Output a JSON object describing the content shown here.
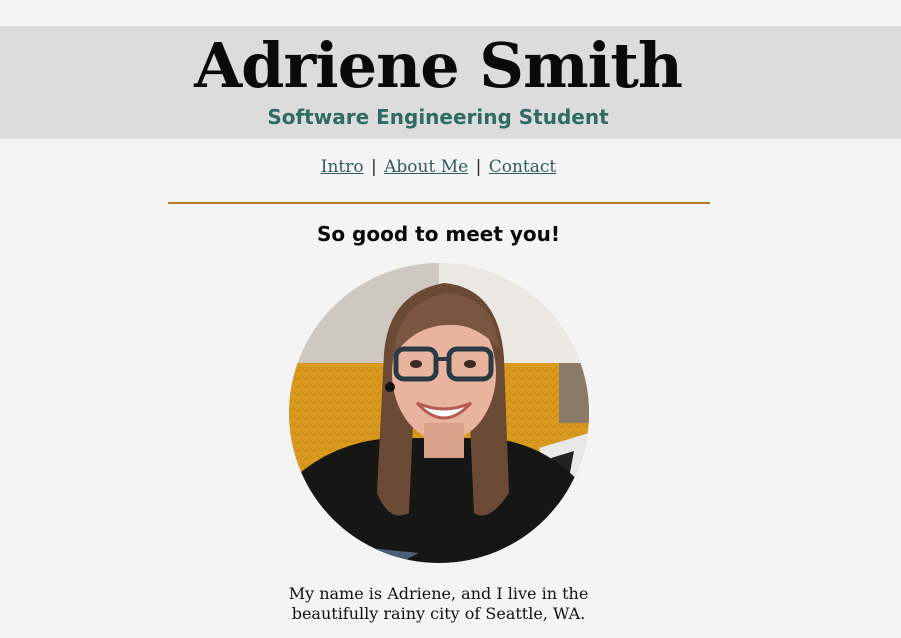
{
  "header": {
    "title": "Adriene Smith",
    "subtitle": "Software Engineering Student"
  },
  "nav": {
    "items": [
      {
        "label": "Intro"
      },
      {
        "label": "About Me"
      },
      {
        "label": "Contact"
      }
    ],
    "separator": "|"
  },
  "intro": {
    "greeting": "So good to meet you!",
    "bio_line1": "My name is Adriene, and I live in the",
    "bio_line2": "beautifully rainy city of Seattle, WA."
  },
  "colors": {
    "background": "#f4f4f4",
    "header_band": "#dcdcdc",
    "subtitle": "#2e6b63",
    "link": "#2e5e5a",
    "divider": "#b07a2a"
  }
}
